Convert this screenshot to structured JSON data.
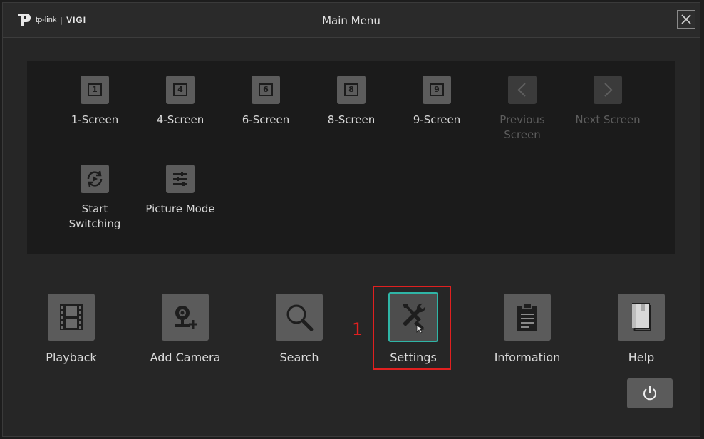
{
  "window": {
    "title": "Main Menu",
    "logo": {
      "brand": "tp-link",
      "separator": "|",
      "product": "VIGI"
    }
  },
  "screen_options": [
    {
      "label": "1-Screen",
      "icon": "one-screen-icon",
      "number": "1",
      "enabled": true
    },
    {
      "label": "4-Screen",
      "icon": "four-screen-icon",
      "number": "4",
      "enabled": true
    },
    {
      "label": "6-Screen",
      "icon": "six-screen-icon",
      "number": "6",
      "enabled": true
    },
    {
      "label": "8-Screen",
      "icon": "eight-screen-icon",
      "number": "8",
      "enabled": true
    },
    {
      "label": "9-Screen",
      "icon": "nine-screen-icon",
      "number": "9",
      "enabled": true
    },
    {
      "label": "Previous Screen",
      "icon": "chevron-left-icon",
      "enabled": false
    },
    {
      "label": "Next Screen",
      "icon": "chevron-right-icon",
      "enabled": false
    },
    {
      "label": "Start Switching",
      "icon": "refresh-play-icon",
      "enabled": true
    },
    {
      "label": "Picture Mode",
      "icon": "sliders-icon",
      "enabled": true
    }
  ],
  "main_items": [
    {
      "label": "Playback",
      "icon": "film-icon"
    },
    {
      "label": "Add Camera",
      "icon": "add-camera-icon"
    },
    {
      "label": "Search",
      "icon": "search-icon"
    },
    {
      "label": "Settings",
      "icon": "tools-icon",
      "active": true
    },
    {
      "label": "Information",
      "icon": "clipboard-icon"
    },
    {
      "label": "Help",
      "icon": "book-icon"
    }
  ],
  "annotation": {
    "step": "1",
    "color": "#e02020"
  },
  "colors": {
    "accent": "#2fb5a6",
    "panel": "#1b1b1b",
    "tile": "#5b5b5b"
  }
}
